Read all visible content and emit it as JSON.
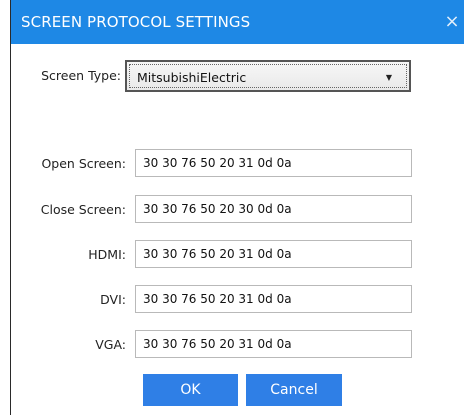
{
  "window": {
    "title": "SCREEN PROTOCOL SETTINGS",
    "close_glyph": "×"
  },
  "screen_type": {
    "label": "Screen Type:",
    "selected": "MitsubishiElectric",
    "arrow_glyph": "▼"
  },
  "fields": [
    {
      "label": "Open Screen:",
      "value": "30 30 76 50 20 31 0d 0a"
    },
    {
      "label": "Close Screen:",
      "value": "30 30 76 50 20 30 0d 0a"
    },
    {
      "label": "HDMI:",
      "value": "30 30 76 50 20 31 0d 0a"
    },
    {
      "label": "DVI:",
      "value": "30 30 76 50 20 31 0d 0a"
    },
    {
      "label": "VGA:",
      "value": "30 30 76 50 20 31 0d 0a"
    }
  ],
  "buttons": {
    "ok_label": "OK",
    "cancel_label": "Cancel"
  },
  "colors": {
    "titlebar": "#1e88e5",
    "button": "#2f7fe6"
  }
}
